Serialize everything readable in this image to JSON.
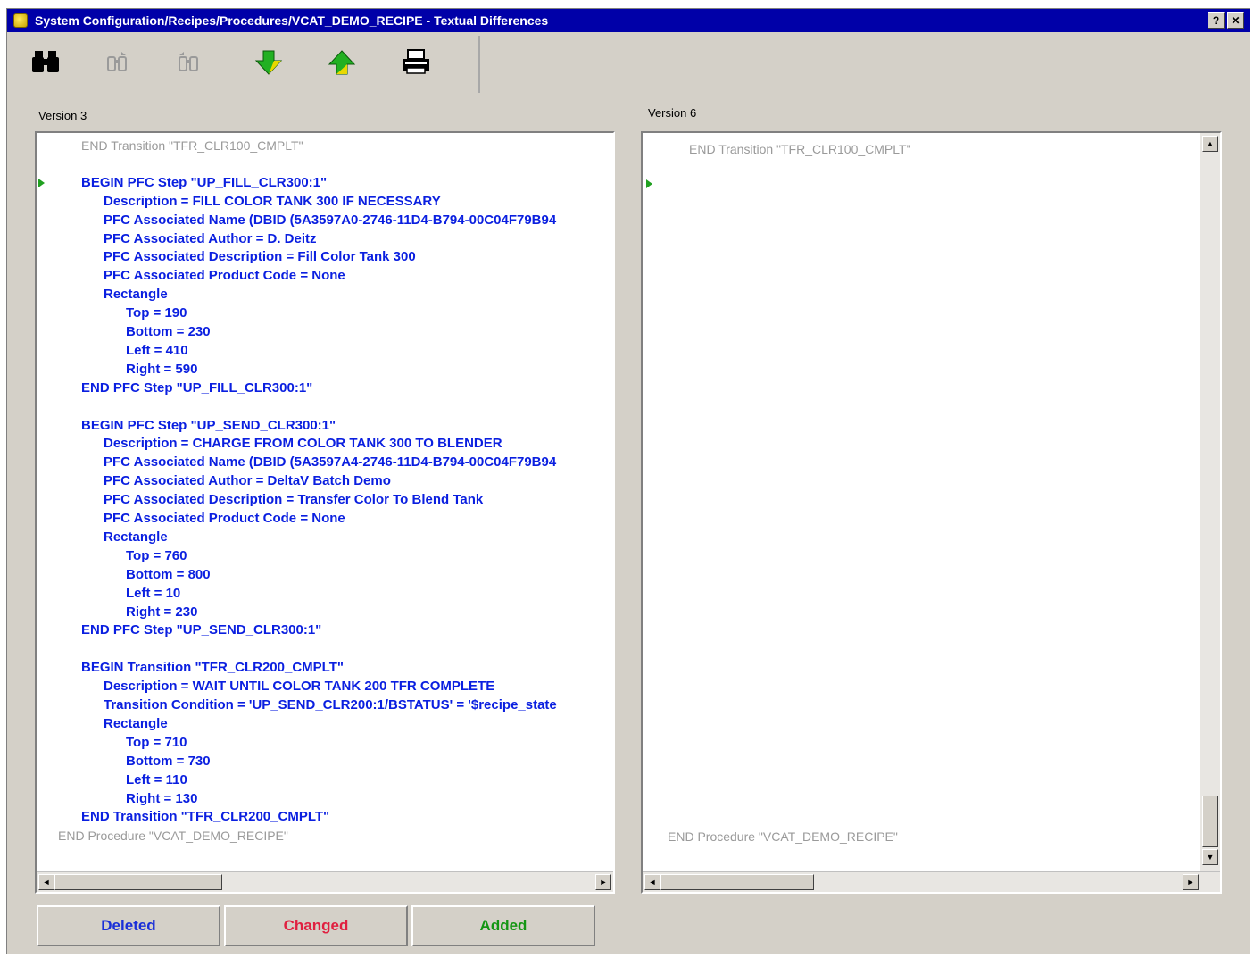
{
  "window": {
    "title": "System Configuration/Recipes/Procedures/VCAT_DEMO_RECIPE - Textual Differences",
    "help_button": "?",
    "close_button": "✕"
  },
  "toolbar": {
    "buttons": [
      {
        "name": "find",
        "icon": "binoculars-icon"
      },
      {
        "name": "find-previous",
        "icon": "find-previous-icon"
      },
      {
        "name": "find-next",
        "icon": "find-next-icon"
      },
      {
        "name": "next-difference",
        "icon": "arrow-down-icon"
      },
      {
        "name": "previous-difference",
        "icon": "arrow-up-icon"
      },
      {
        "name": "print",
        "icon": "printer-icon"
      }
    ]
  },
  "left_pane": {
    "label": "Version 3",
    "lines": [
      {
        "text": "END Transition \"TFR_CLR100_CMPLT\"",
        "style": "ctx",
        "indent": 2
      },
      {
        "text": "",
        "style": "del",
        "indent": 0
      },
      {
        "text": "BEGIN PFC Step \"UP_FILL_CLR300:1\"",
        "style": "del",
        "indent": 2
      },
      {
        "text": "Description = FILL COLOR TANK 300 IF NECESSARY",
        "style": "del",
        "indent": 3
      },
      {
        "text": "PFC Associated Name (DBID (5A3597A0-2746-11D4-B794-00C04F79B94",
        "style": "del",
        "indent": 3
      },
      {
        "text": "PFC Associated Author = D. Deitz",
        "style": "del",
        "indent": 3
      },
      {
        "text": "PFC Associated Description = Fill Color Tank 300",
        "style": "del",
        "indent": 3
      },
      {
        "text": "PFC Associated Product Code = None",
        "style": "del",
        "indent": 3
      },
      {
        "text": "Rectangle",
        "style": "del",
        "indent": 3
      },
      {
        "text": "Top = 190",
        "style": "del",
        "indent": 4
      },
      {
        "text": "Bottom = 230",
        "style": "del",
        "indent": 4
      },
      {
        "text": "Left = 410",
        "style": "del",
        "indent": 4
      },
      {
        "text": "Right = 590",
        "style": "del",
        "indent": 4
      },
      {
        "text": "END PFC Step \"UP_FILL_CLR300:1\"",
        "style": "del",
        "indent": 2
      },
      {
        "text": "",
        "style": "del",
        "indent": 0
      },
      {
        "text": "BEGIN PFC Step \"UP_SEND_CLR300:1\"",
        "style": "del",
        "indent": 2
      },
      {
        "text": "Description = CHARGE FROM COLOR TANK 300 TO BLENDER",
        "style": "del",
        "indent": 3
      },
      {
        "text": "PFC Associated Name (DBID (5A3597A4-2746-11D4-B794-00C04F79B94",
        "style": "del",
        "indent": 3
      },
      {
        "text": "PFC Associated Author = DeltaV Batch Demo",
        "style": "del",
        "indent": 3
      },
      {
        "text": "PFC Associated Description = Transfer Color To Blend Tank",
        "style": "del",
        "indent": 3
      },
      {
        "text": "PFC Associated Product Code = None",
        "style": "del",
        "indent": 3
      },
      {
        "text": "Rectangle",
        "style": "del",
        "indent": 3
      },
      {
        "text": "Top = 760",
        "style": "del",
        "indent": 4
      },
      {
        "text": "Bottom = 800",
        "style": "del",
        "indent": 4
      },
      {
        "text": "Left = 10",
        "style": "del",
        "indent": 4
      },
      {
        "text": "Right = 230",
        "style": "del",
        "indent": 4
      },
      {
        "text": "END PFC Step \"UP_SEND_CLR300:1\"",
        "style": "del",
        "indent": 2
      },
      {
        "text": "",
        "style": "del",
        "indent": 0
      },
      {
        "text": "BEGIN Transition \"TFR_CLR200_CMPLT\"",
        "style": "del",
        "indent": 2
      },
      {
        "text": "Description = WAIT UNTIL COLOR TANK 200 TFR COMPLETE",
        "style": "del",
        "indent": 3
      },
      {
        "text": "Transition Condition = 'UP_SEND_CLR200:1/BSTATUS' = '$recipe_state",
        "style": "del",
        "indent": 3
      },
      {
        "text": "Rectangle",
        "style": "del",
        "indent": 3
      },
      {
        "text": "Top = 710",
        "style": "del",
        "indent": 4
      },
      {
        "text": "Bottom = 730",
        "style": "del",
        "indent": 4
      },
      {
        "text": "Left = 110",
        "style": "del",
        "indent": 4
      },
      {
        "text": "Right = 130",
        "style": "del",
        "indent": 4
      },
      {
        "text": "END Transition \"TFR_CLR200_CMPLT\"",
        "style": "del",
        "indent": 2
      },
      {
        "text": "END Procedure \"VCAT_DEMO_RECIPE\"",
        "style": "ctx",
        "indent": 1
      }
    ]
  },
  "right_pane": {
    "label": "Version 6",
    "top_line": "END Transition \"TFR_CLR100_CMPLT\"",
    "bottom_line": "END Procedure \"VCAT_DEMO_RECIPE\""
  },
  "legend": {
    "deleted": {
      "label": "Deleted",
      "color": "#1a2fd8"
    },
    "changed": {
      "label": "Changed",
      "color": "#e02040"
    },
    "added": {
      "label": "Added",
      "color": "#149614"
    }
  },
  "colors": {
    "title_bar": "#0000a8",
    "deleted_text": "#0a1fe0",
    "context_text": "#9a9a9a",
    "marker": "#20a020"
  }
}
